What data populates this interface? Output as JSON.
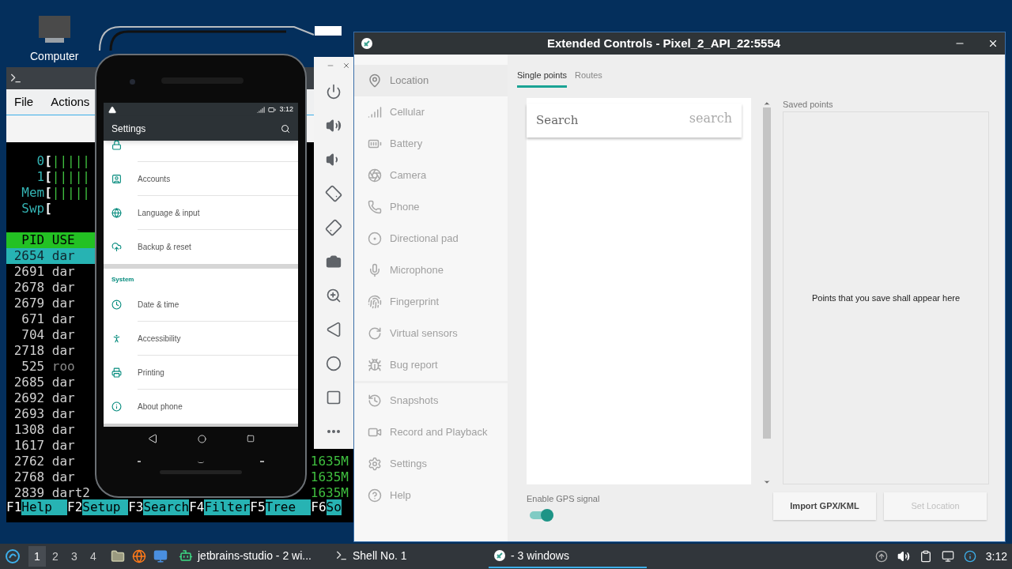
{
  "desktop": {
    "icons": [
      {
        "label": "Computer"
      }
    ]
  },
  "terminal": {
    "menu": [
      "File",
      "Actions"
    ],
    "meters": [
      {
        "label": "0",
        "bracket": "[",
        "bars": "|||||"
      },
      {
        "label": "1",
        "bracket": "[",
        "bars": "|||||"
      },
      {
        "label": "Mem",
        "bracket": "[",
        "bars": "|||||"
      },
      {
        "label": "Swp",
        "bracket": "["
      }
    ],
    "header": "PID USE",
    "rows": [
      {
        "pid": "2654",
        "user": "dar",
        "selected": true,
        "dimmed": false
      },
      {
        "pid": "2691",
        "user": "dar",
        "selected": false,
        "dimmed": false
      },
      {
        "pid": "2678",
        "user": "dar",
        "selected": false,
        "dimmed": false
      },
      {
        "pid": "2679",
        "user": "dar",
        "selected": false,
        "dimmed": false
      },
      {
        "pid": "671",
        "user": "dar",
        "selected": false,
        "dimmed": false
      },
      {
        "pid": "704",
        "user": "dar",
        "selected": false,
        "dimmed": false
      },
      {
        "pid": "2718",
        "user": "dar",
        "selected": false,
        "dimmed": false
      },
      {
        "pid": "525",
        "user": "roo",
        "selected": false,
        "dimmed": true
      },
      {
        "pid": "2685",
        "user": "dar",
        "selected": false,
        "dimmed": false
      },
      {
        "pid": "2692",
        "user": "dar",
        "selected": false,
        "dimmed": false
      },
      {
        "pid": "2693",
        "user": "dar",
        "selected": false,
        "dimmed": false
      },
      {
        "pid": "1308",
        "user": "dar",
        "selected": false,
        "dimmed": false
      },
      {
        "pid": "1617",
        "user": "dar",
        "selected": false,
        "dimmed": false
      },
      {
        "pid": "2762",
        "user": "dar",
        "selected": false,
        "dimmed": false,
        "column_7": "1635M"
      },
      {
        "pid": "2768",
        "user": "dar",
        "selected": false,
        "dimmed": false,
        "column_7": "1635M"
      },
      {
        "pid": "2839",
        "user": "dart2",
        "selected": false,
        "dimmed": false,
        "column_7": "1635M"
      }
    ],
    "function_keys": [
      {
        "key": "F1",
        "label": "Help"
      },
      {
        "key": "F2",
        "label": "Setup"
      },
      {
        "key": "F3",
        "label": "Search"
      },
      {
        "key": "F4",
        "label": "Filter"
      },
      {
        "key": "F5",
        "label": "Tree"
      },
      {
        "key": "F6",
        "label": "So"
      }
    ]
  },
  "phone": {
    "status_time": "3:12",
    "title": "Settings",
    "sections": [
      {
        "items": [
          {
            "kind": "security"
          },
          {
            "kind": "accounts",
            "label": "Accounts"
          },
          {
            "kind": "language",
            "label": "Language & input"
          },
          {
            "kind": "backup",
            "label": "Backup & reset"
          }
        ]
      },
      {
        "title": "System",
        "items": [
          {
            "kind": "clock",
            "label": "Date & time"
          },
          {
            "kind": "accessibility",
            "label": "Accessibility"
          },
          {
            "kind": "printing",
            "label": "Printing"
          },
          {
            "kind": "info",
            "label": "About phone"
          }
        ]
      }
    ]
  },
  "extended_controls": {
    "title": "Extended Controls - Pixel_2_API_22:5554",
    "sidebar": {
      "groups": [
        {
          "items": [
            {
              "kind": "location",
              "label": "Location",
              "selected": true
            },
            {
              "kind": "cellular",
              "label": "Cellular",
              "selected": false
            },
            {
              "kind": "battery",
              "label": "Battery",
              "selected": false
            },
            {
              "kind": "camera",
              "label": "Camera",
              "selected": false
            },
            {
              "kind": "phone",
              "label": "Phone",
              "selected": false
            },
            {
              "kind": "dpad",
              "label": "Directional pad",
              "selected": false
            },
            {
              "kind": "microphone",
              "label": "Microphone",
              "selected": false
            },
            {
              "kind": "fingerprint",
              "label": "Fingerprint",
              "selected": false
            },
            {
              "kind": "sensors",
              "label": "Virtual sensors",
              "selected": false
            },
            {
              "kind": "bug",
              "label": "Bug report",
              "selected": false
            }
          ]
        },
        {
          "items": [
            {
              "kind": "snapshots",
              "label": "Snapshots",
              "selected": false
            },
            {
              "kind": "record",
              "label": "Record and Playback",
              "selected": false
            },
            {
              "kind": "settings",
              "label": "Settings",
              "selected": false
            },
            {
              "kind": "help",
              "label": "Help",
              "selected": false
            }
          ]
        }
      ]
    },
    "tabs": [
      {
        "label": "Single points",
        "selected": true
      },
      {
        "label": "Routes",
        "selected": false
      }
    ],
    "search": {
      "placeholder": "Search",
      "icon_text": "search"
    },
    "saved_points": {
      "label": "Saved points",
      "empty_text": "Points that you save shall appear here"
    },
    "gps": {
      "label": "Enable GPS signal",
      "on": true
    },
    "buttons": [
      {
        "label": "Import GPX/KML",
        "disabled": false
      },
      {
        "label": "Set Location",
        "disabled": true
      }
    ]
  },
  "taskbar": {
    "workspaces": [
      {
        "label": "1",
        "selected": true
      },
      {
        "label": "2",
        "selected": false
      },
      {
        "label": "3",
        "selected": false
      },
      {
        "label": "4",
        "selected": false
      }
    ],
    "tasks": [
      {
        "kind": "android",
        "label": "jetbrains-studio - 2 wi...",
        "selected": false
      },
      {
        "kind": "terminal",
        "label": "Shell No. 1",
        "selected": false
      },
      {
        "kind": "emulator",
        "label": "- 3 windows",
        "selected": true
      }
    ],
    "clock": "3:12"
  }
}
